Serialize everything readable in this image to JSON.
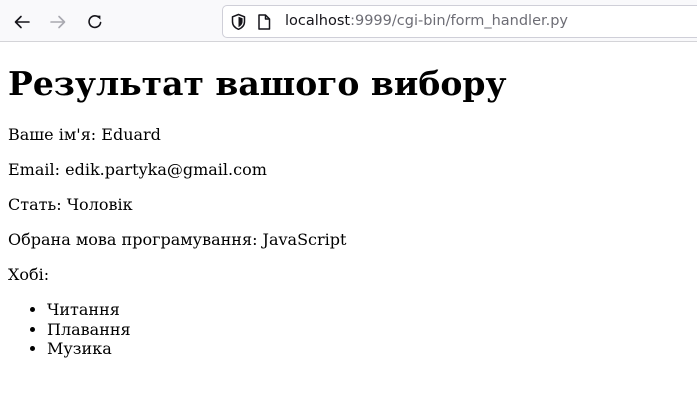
{
  "browser": {
    "url_host": "localhost",
    "url_rest": ":9999/cgi-bin/form_handler.py",
    "icons": {
      "back": "arrow-left-icon",
      "forward": "arrow-right-icon",
      "reload": "reload-icon",
      "shield": "shield-icon",
      "page": "page-icon"
    }
  },
  "page": {
    "heading": "Результат вашого вибору",
    "name_label": "Ваше ім'я:",
    "name_value": "Eduard",
    "email_label": "Email:",
    "email_value": "edik.partyka@gmail.com",
    "gender_label": "Стать:",
    "gender_value": "Чоловік",
    "lang_label": "Обрана мова програмування:",
    "lang_value": "JavaScript",
    "hobbies_label": "Хобі:",
    "hobbies": [
      "Читання",
      "Плавання",
      "Музика"
    ]
  }
}
